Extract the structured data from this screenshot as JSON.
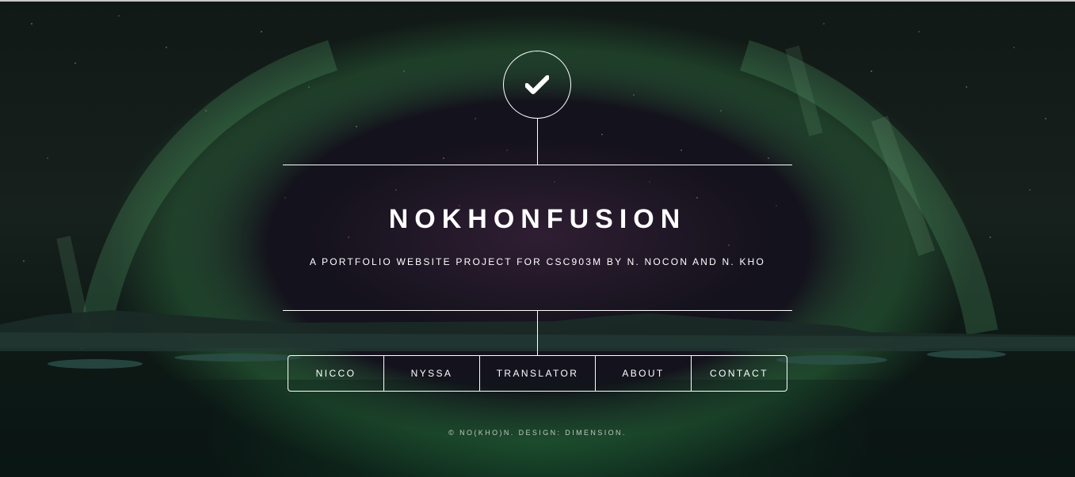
{
  "header": {
    "logo_icon": "checkmark-icon",
    "title": "NOKHONFUSION",
    "subtitle": "A PORTFOLIO WEBSITE PROJECT FOR CSC903M BY N. NOCON AND N. KHO"
  },
  "nav": {
    "items": [
      {
        "label": "NICCO"
      },
      {
        "label": "NYSSA"
      },
      {
        "label": "TRANSLATOR"
      },
      {
        "label": "ABOUT"
      },
      {
        "label": "CONTACT"
      }
    ]
  },
  "footer": {
    "text": "© NO(KHO)N. DESIGN: DIMENSION."
  },
  "colors": {
    "foreground": "#ffffff",
    "aurora": "#3c9650",
    "sky": "#14121c"
  }
}
